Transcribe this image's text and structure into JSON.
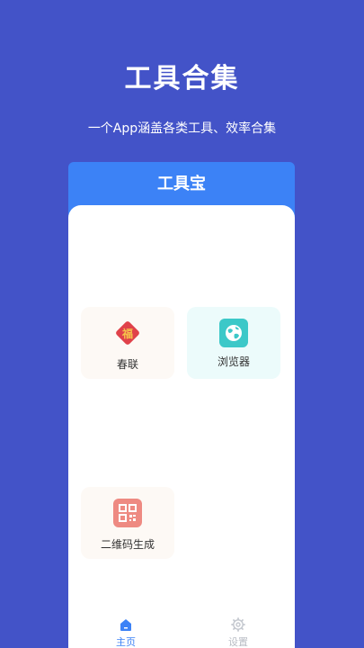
{
  "promo": {
    "title": "工具合集",
    "subtitle": "一个App涵盖各类工具、效率合集"
  },
  "app": {
    "header_title": "工具宝"
  },
  "tools": [
    {
      "label": "春联",
      "icon": "fu-couplet-icon",
      "color": "#e0424a"
    },
    {
      "label": "浏览器",
      "icon": "globe-icon",
      "color": "#3cc8c8"
    },
    {
      "label": "二维码生成",
      "icon": "qr-code-icon",
      "color": "#ee8a82"
    }
  ],
  "tabbar": {
    "items": [
      {
        "label": "主页",
        "icon": "home-icon",
        "active": true
      },
      {
        "label": "设置",
        "icon": "gear-icon",
        "active": false
      }
    ]
  },
  "colors": {
    "background": "#4353c8",
    "accent": "#3c82f6"
  }
}
